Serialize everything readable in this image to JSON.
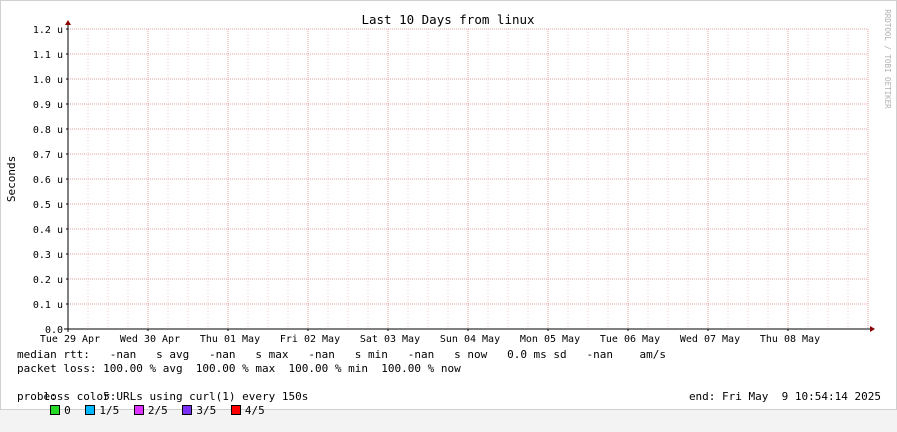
{
  "chart_data": {
    "type": "line",
    "title": "Last 10 Days from linux",
    "ylabel": "Seconds",
    "xlabel": "",
    "ylim": [
      0.0,
      1.2
    ],
    "y_unit_suffix": "u",
    "y_ticks": [
      "0.0",
      "0.1 u",
      "0.2 u",
      "0.3 u",
      "0.4 u",
      "0.5 u",
      "0.6 u",
      "0.7 u",
      "0.8 u",
      "0.9 u",
      "1.0 u",
      "1.1 u",
      "1.2 u"
    ],
    "x_ticks": [
      "Tue 29 Apr",
      "Wed 30 Apr",
      "Thu 01 May",
      "Fri 02 May",
      "Sat 03 May",
      "Sun 04 May",
      "Mon 05 May",
      "Tue 06 May",
      "Wed 07 May",
      "Thu 08 May"
    ],
    "series": [],
    "grid": true,
    "grid_color": "#e6a0a0",
    "watermark": "RRDTOOL / TOBI OETIKER"
  },
  "legend": {
    "median_rtt": "median rtt:   -nan   s avg   -nan   s max   -nan   s min   -nan   s now   0.0 ms sd   -nan    am/s",
    "packet_loss": "packet loss: 100.00 % avg  100.00 % max  100.00 % min  100.00 % now",
    "loss_color_label": "loss color:",
    "loss_colors": [
      {
        "label": "0",
        "color": "#26d926"
      },
      {
        "label": "1/5",
        "color": "#00b8ff"
      },
      {
        "label": "2/5",
        "color": "#dd33ff"
      },
      {
        "label": "3/5",
        "color": "#7b2ff7"
      },
      {
        "label": "4/5",
        "color": "#ff0000"
      }
    ],
    "probe": "probe:       5 URLs using curl(1) every 150s",
    "end": "end: Fri May  9 10:54:14 2025"
  }
}
